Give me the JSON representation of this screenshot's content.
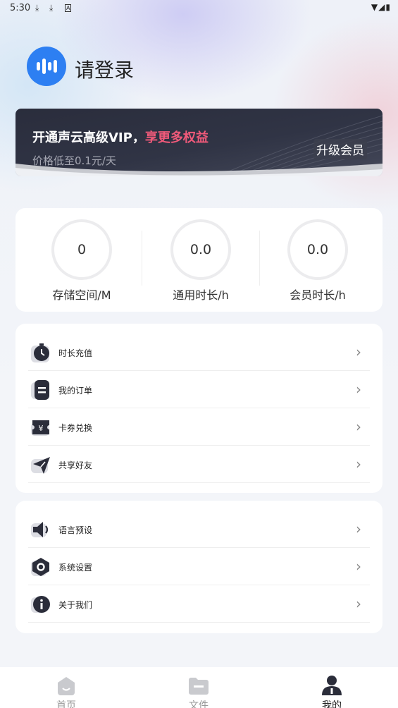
{
  "status_bar": {
    "time": "5:30",
    "download_icon": "download-icon",
    "wifi_icon": "wifi-icon",
    "signal_icon": "signal-icon",
    "battery_icon": "battery-icon"
  },
  "header": {
    "logo_icon": "voice-wave-logo",
    "login_text": "请登录"
  },
  "vip_banner": {
    "title_prefix": "开通声云高级VIP，",
    "title_highlight": "享更多权益",
    "subtitle": "价格低至0.1元/天",
    "upgrade_button": "升级会员",
    "accent_color": "#f05a7a"
  },
  "stats": [
    {
      "value": "0",
      "label": "存储空间/M"
    },
    {
      "value": "0.0",
      "label": "通用时长/h"
    },
    {
      "value": "0.0",
      "label": "会员时长/h"
    }
  ],
  "menu_group_1": [
    {
      "label": "时长充值",
      "icon": "stopwatch-icon"
    },
    {
      "label": "我的订单",
      "icon": "order-icon"
    },
    {
      "label": "卡券兑换",
      "icon": "coupon-icon"
    },
    {
      "label": "共享好友",
      "icon": "share-plane-icon"
    }
  ],
  "menu_group_2": [
    {
      "label": "语言预设",
      "icon": "speaker-icon"
    },
    {
      "label": "系统设置",
      "icon": "settings-icon"
    },
    {
      "label": "关于我们",
      "icon": "info-icon"
    }
  ],
  "bottom_nav": [
    {
      "label": "首页",
      "icon": "home-icon",
      "active": false
    },
    {
      "label": "文件",
      "icon": "folder-icon",
      "active": false
    },
    {
      "label": "我的",
      "icon": "profile-icon",
      "active": true
    }
  ],
  "colors": {
    "brand_blue": "#2d7ff2",
    "icon_dark": "#2b2d3a",
    "background": "#f3f5f9"
  }
}
